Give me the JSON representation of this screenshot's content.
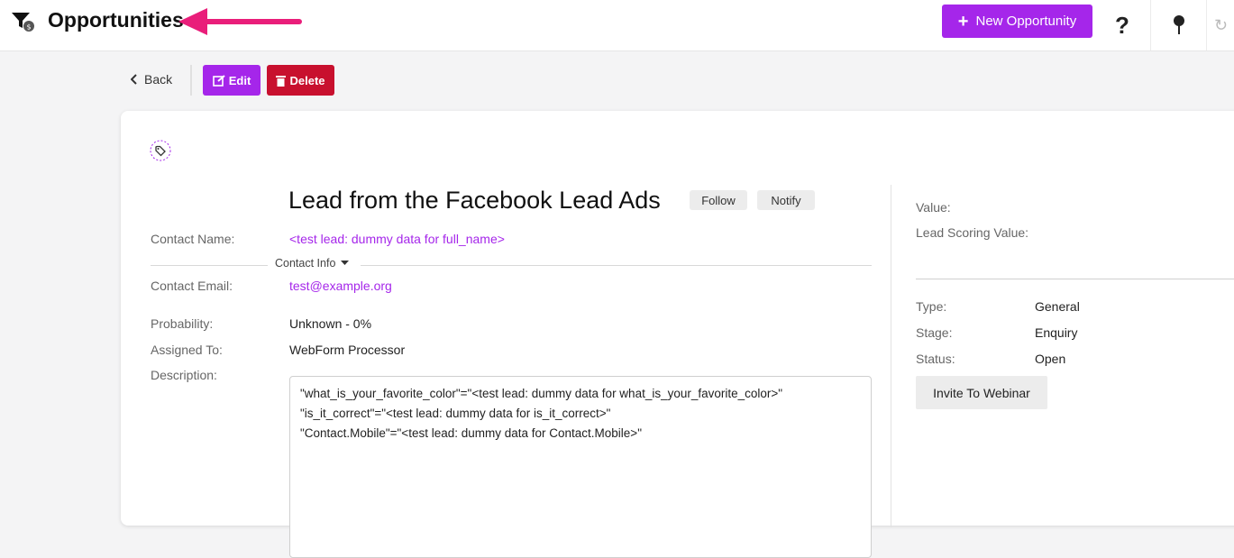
{
  "header": {
    "title": "Opportunities",
    "new_button_label": "New Opportunity",
    "help_icon": "question-mark-icon",
    "pin_icon": "pin-icon"
  },
  "actions": {
    "back_label": "Back",
    "edit_label": "Edit",
    "delete_label": "Delete"
  },
  "opportunity": {
    "title": "Lead from the Facebook Lead Ads",
    "follow_label": "Follow",
    "notify_label": "Notify",
    "fields": {
      "contact_name_label": "Contact Name:",
      "contact_name_value": "<test lead: dummy data for full_name>",
      "contact_info_label": "Contact Info",
      "contact_email_label": "Contact Email:",
      "contact_email_value": "test@example.org",
      "probability_label": "Probability:",
      "probability_value": "Unknown - 0%",
      "assigned_label": "Assigned To:",
      "assigned_value": "WebForm Processor",
      "description_label": "Description:"
    },
    "description_lines": [
      "\"what_is_your_favorite_color\"=\"<test lead: dummy data for what_is_your_favorite_color>\"",
      "\"is_it_correct\"=\"<test lead: dummy data for is_it_correct>\"",
      "\"Contact.Mobile\"=\"<test lead: dummy data for Contact.Mobile>\""
    ]
  },
  "side": {
    "value_label": "Value:",
    "lead_scoring_label": "Lead Scoring Value:",
    "type_label": "Type:",
    "type_value": "General",
    "stage_label": "Stage:",
    "stage_value": "Enquiry",
    "status_label": "Status:",
    "status_value": "Open",
    "webinar_button": "Invite To Webinar"
  },
  "colors": {
    "accent": "#a526ea",
    "danger": "#c8102e",
    "arrow": "#e91e7a"
  }
}
